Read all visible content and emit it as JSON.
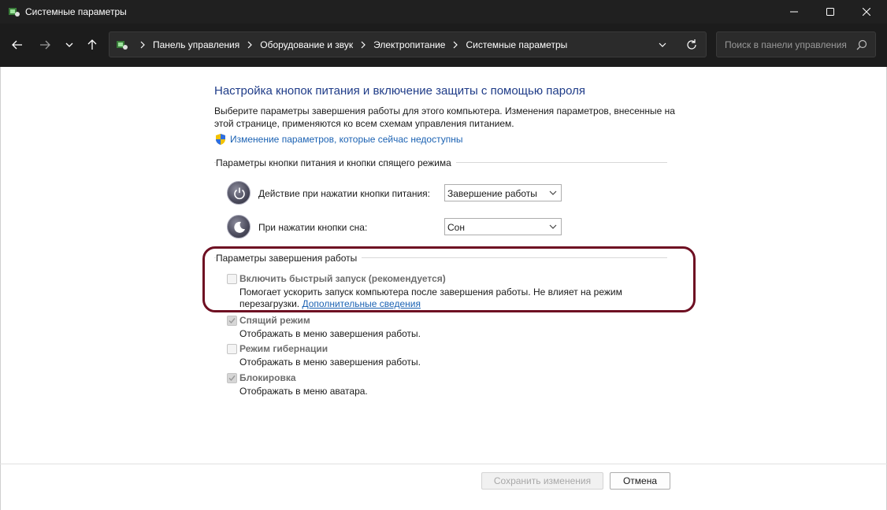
{
  "window": {
    "title": "Системные параметры",
    "controls": [
      "minimize-icon",
      "maximize-icon",
      "close-icon"
    ]
  },
  "nav": {
    "buttons": [
      "back-arrow-icon",
      "forward-arrow-icon",
      "recent-chevron-icon",
      "up-arrow-icon"
    ]
  },
  "breadcrumb": {
    "items": [
      "Панель управления",
      "Оборудование и звук",
      "Электропитание",
      "Системные параметры"
    ]
  },
  "search": {
    "placeholder": "Поиск в панели управления"
  },
  "page": {
    "title": "Настройка кнопок питания и включение защиты с помощью пароля",
    "description": "Выберите параметры завершения работы для этого компьютера. Изменения параметров, внесенные на этой странице, применяются ко всем схемам управления питанием.",
    "admin_link": "Изменение параметров, которые сейчас недоступны"
  },
  "buttons_section": {
    "title": "Параметры кнопки питания и кнопки спящего режима",
    "rows": [
      {
        "label": "Действие при нажатии кнопки питания:",
        "value": "Завершение работы",
        "icon": "power-button-icon"
      },
      {
        "label": "При нажатии кнопки сна:",
        "value": "Сон",
        "icon": "sleep-button-icon"
      }
    ]
  },
  "shutdown_section": {
    "title": "Параметры завершения работы",
    "options": [
      {
        "title": "Включить быстрый запуск (рекомендуется)",
        "desc": "Помогает ускорить запуск компьютера после завершения работы. Не влияет на режим",
        "desc2": "перезагрузки.",
        "link": "Дополнительные сведения",
        "checked": false
      },
      {
        "title": "Спящий режим",
        "desc": "Отображать в меню завершения работы.",
        "checked": true
      },
      {
        "title": "Режим гибернации",
        "desc": "Отображать в меню завершения работы.",
        "checked": false
      },
      {
        "title": "Блокировка",
        "desc": "Отображать в меню аватара.",
        "checked": true
      }
    ]
  },
  "footer": {
    "save_label": "Сохранить изменения",
    "cancel_label": "Отмена"
  },
  "colors": {
    "titlebar": "#202020",
    "link": "#1b62b3",
    "heading": "#1f3c88",
    "highlight": "#6e0f22"
  }
}
